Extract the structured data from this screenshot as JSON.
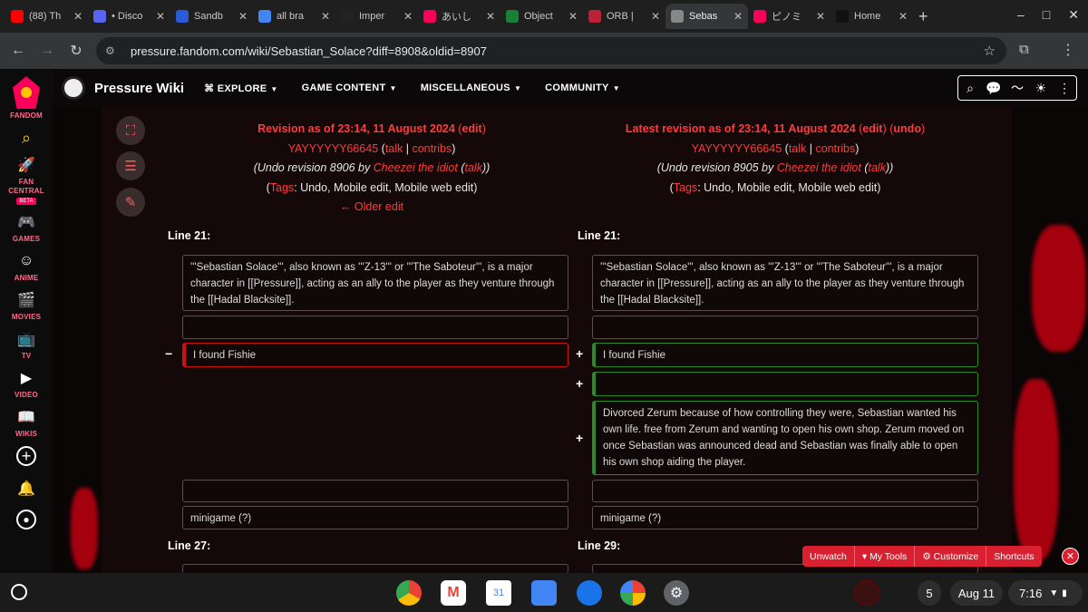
{
  "browser": {
    "tabs": [
      {
        "title": "(88) Th",
        "color": "#ff0000"
      },
      {
        "title": "• Disco",
        "color": "#5865f2"
      },
      {
        "title": "Sandb",
        "color": "#2a5bd7"
      },
      {
        "title": "all bra",
        "color": "#4285f4"
      },
      {
        "title": "Imper",
        "color": "#222222"
      },
      {
        "title": "あいし",
        "color": "#fa005a"
      },
      {
        "title": "Object",
        "color": "#1a7f37"
      },
      {
        "title": "ORB |",
        "color": "#b23"
      },
      {
        "title": "Sebas",
        "color": "#888888"
      },
      {
        "title": "ピノミ",
        "color": "#fa005a"
      },
      {
        "title": "Home",
        "color": "#111111"
      }
    ],
    "url": "pressure.fandom.com/wiki/Sebastian_Solace?diff=8908&oldid=8907"
  },
  "rail": {
    "fandom": "FANDOM",
    "fan_central": "FAN CENTRAL",
    "beta": "BETA",
    "games": "GAMES",
    "anime": "ANIME",
    "movies": "MOVIES",
    "tv": "TV",
    "video": "VIDEO",
    "wikis": "WIKIS"
  },
  "wiki": {
    "name": "Pressure Wiki",
    "nav": [
      "EXPLORE",
      "GAME CONTENT",
      "MISCELLANEOUS",
      "COMMUNITY"
    ]
  },
  "left": {
    "revision_label": "Revision as of 23:14, 11 August 2024",
    "edit": "edit",
    "user": "YAYYYYYY66645",
    "talk": "talk",
    "contribs": "contribs",
    "summary_prefix": "(Undo revision 8906 by ",
    "summary_user": "Cheezei the idiot",
    "tags_label": "Tags",
    "tags_values": ": Undo, Mobile edit, Mobile web edit)",
    "older_edit": "← Older edit",
    "line_top": "Line 21:",
    "line_bottom": "Line 27:"
  },
  "right": {
    "revision_label": "Latest revision as of 23:14, 11 August 2024",
    "edit": "edit",
    "undo": "undo",
    "user": "YAYYYYYY66645",
    "talk": "talk",
    "contribs": "contribs",
    "summary_prefix": "(Undo revision 8905 by ",
    "summary_user": "Cheezei the idiot",
    "tags_label": "Tags",
    "tags_values": ": Undo, Mobile edit, Mobile web edit)",
    "line_top": "Line 21:",
    "line_bottom": "Line 29:"
  },
  "diff": {
    "intro": "'''Sebastian Solace''', also known as '''Z-13''' or '''The Saboteur''', is a major character in [[Pressure]], acting as an ally to the player as they venture through the [[Hadal Blacksite]].",
    "deleted_line": "I found Fishie",
    "added_line": "I found Fishie",
    "added_paragraph": "Divorced Zerum because of how controlling they were, Sebastian wanted his own life. free from Zerum and wanting to open his own shop. Zerum moved on once Sebastian was announced dead and Sebastian was finally able to open his own shop aiding the player.",
    "minigame": "minigame (?)",
    "minus": "−",
    "plus": "+"
  },
  "floating_toolbar": {
    "unwatch": "Unwatch",
    "my_tools": "My Tools",
    "customize": "Customize",
    "shortcuts": "Shortcuts"
  },
  "shelf": {
    "notifications": "5",
    "date": "Aug 11",
    "time": "7:16"
  }
}
